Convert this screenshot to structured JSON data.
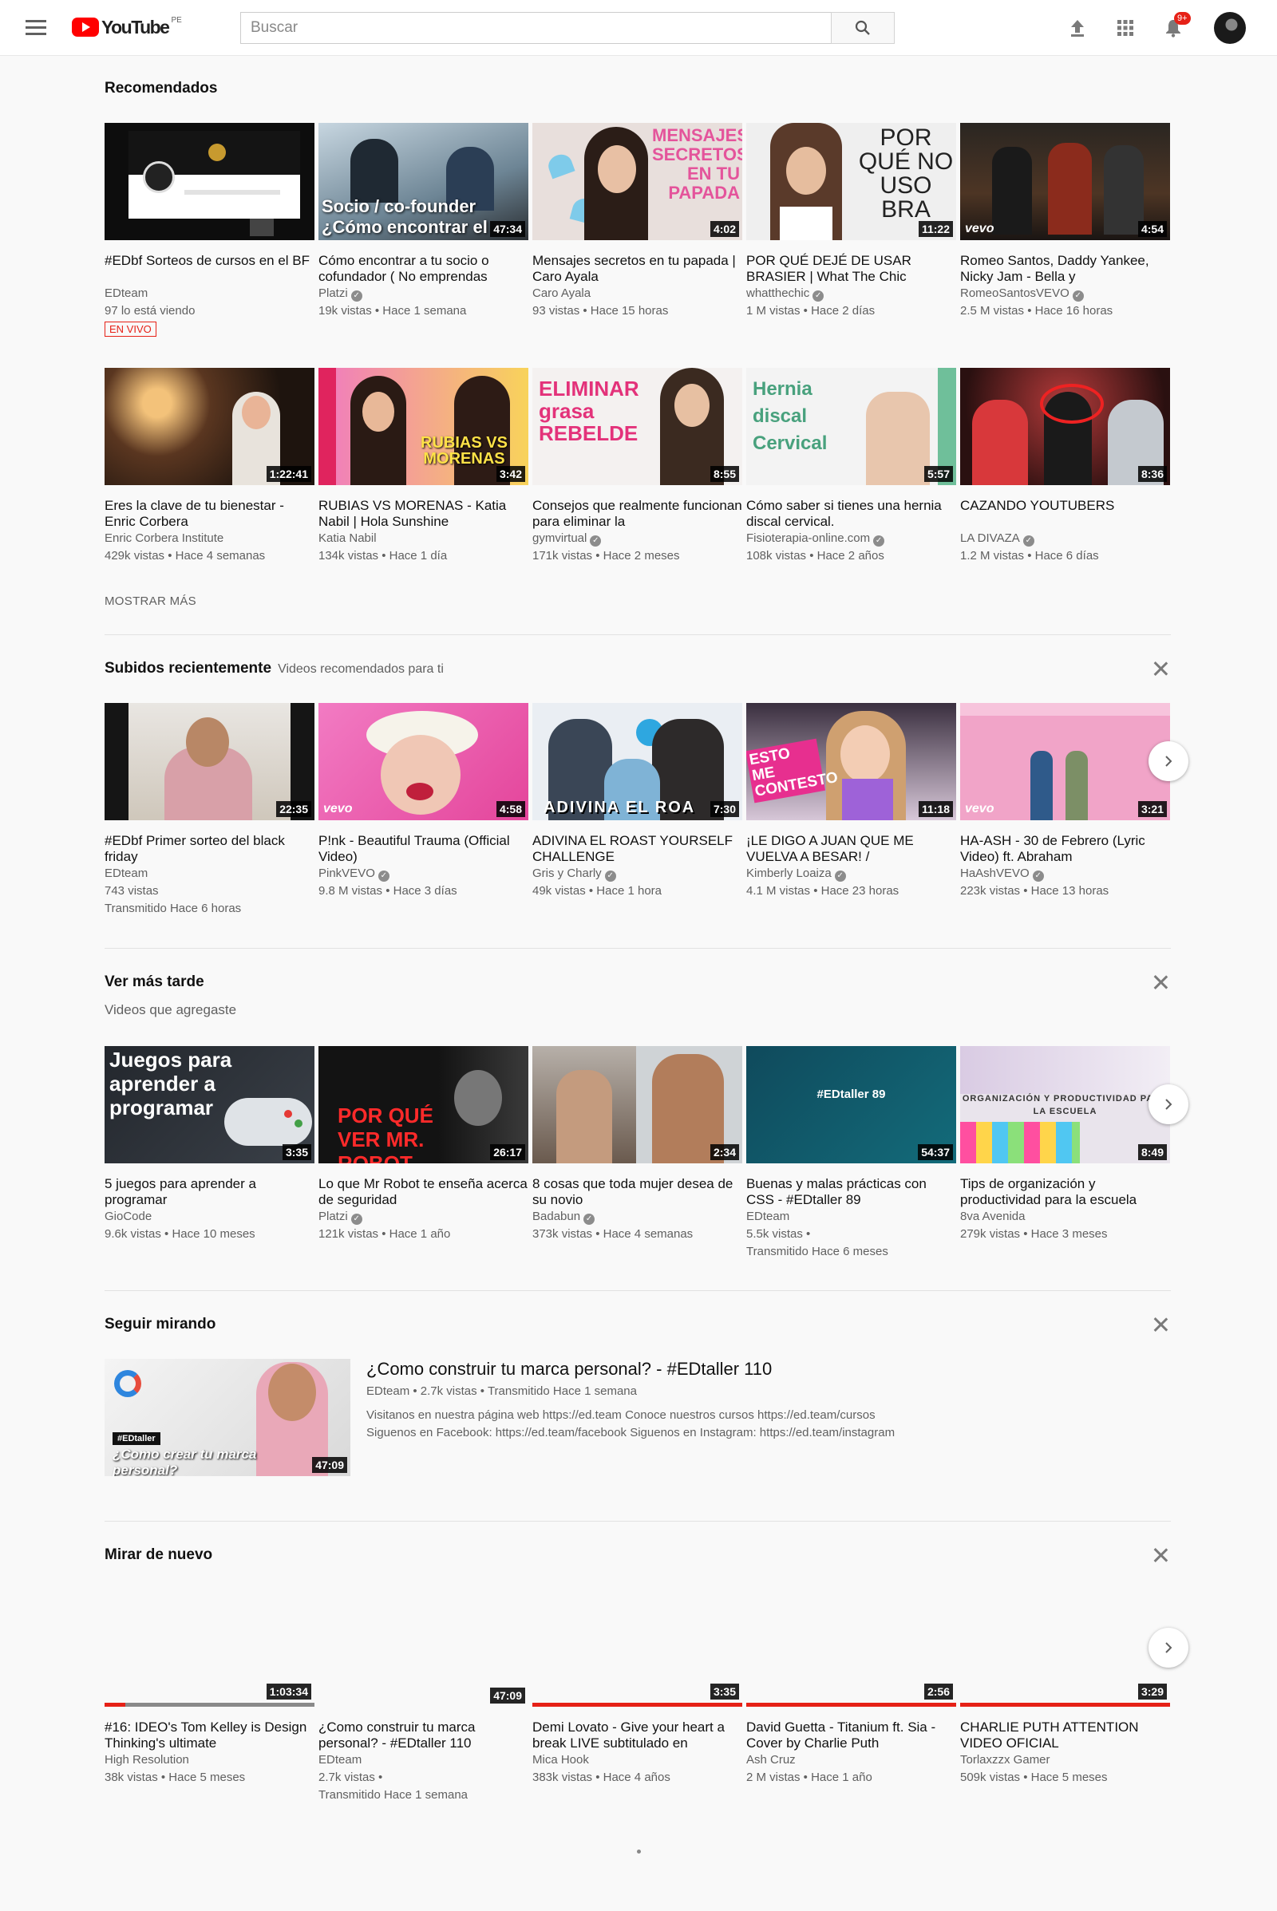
{
  "header": {
    "logo_text": "YouTube",
    "country_code": "PE",
    "search_placeholder": "Buscar",
    "notification_count": "9+"
  },
  "recommended": {
    "title": "Recomendados",
    "show_more": "MOSTRAR MÁS",
    "row1": [
      {
        "title": "#EDbf Sorteos de cursos en el BF",
        "channel": "EDteam",
        "meta": "97 lo está viendo",
        "live": "EN VIVO",
        "duration": ""
      },
      {
        "title": "Cómo encontrar a tu socio o cofundador ( No emprendas",
        "channel": "Platzi",
        "verified": true,
        "meta": "19k vistas • Hace 1 semana",
        "duration": "47:34",
        "thumb_text": "Socio / co-founder ¿Cómo encontrar el correc"
      },
      {
        "title": "Mensajes secretos en tu papada | Caro Ayala",
        "channel": "Caro Ayala",
        "meta": "93 vistas • Hace 15 horas",
        "duration": "4:02",
        "thumb_text": "MENSAJES SECRETOS EN TU PAPADA"
      },
      {
        "title": "POR QUÉ DEJÉ DE USAR BRASIER | What The Chic",
        "channel": "whatthechic",
        "verified": true,
        "meta": "1 M vistas • Hace 2 días",
        "duration": "11:22",
        "thumb_text": "POR QUÉ NO USO BRA"
      },
      {
        "title": "Romeo Santos, Daddy Yankee, Nicky Jam - Bella y",
        "channel": "RomeoSantosVEVO",
        "verified": true,
        "meta": "2.5 M vistas • Hace 16 horas",
        "duration": "4:54",
        "thumb_text": "vevo"
      }
    ],
    "row2": [
      {
        "title": "Eres la clave de tu bienestar - Enric Corbera",
        "channel": "Enric Corbera Institute",
        "meta": "429k vistas • Hace 4 semanas",
        "duration": "1:22:41"
      },
      {
        "title": "RUBIAS VS MORENAS - Katia Nabil | Hola Sunshine",
        "channel": "Katia Nabil",
        "meta": "134k vistas • Hace 1 día",
        "duration": "3:42",
        "thumb_text": "RUBIAS VS MORENAS"
      },
      {
        "title": "Consejos que realmente funcionan para eliminar la",
        "channel": "gymvirtual",
        "verified": true,
        "meta": "171k vistas • Hace 2 meses",
        "duration": "8:55",
        "thumb_text": "ELIMINAR grasa REBELDE"
      },
      {
        "title": "Cómo saber si tienes una hernia discal cervical.",
        "channel": "Fisioterapia-online.com",
        "verified": true,
        "meta": "108k vistas • Hace 2 años",
        "duration": "5:57",
        "thumb_text": "Hernia discal Cervical"
      },
      {
        "title": "CAZANDO YOUTUBERS",
        "channel": "LA DIVAZA",
        "verified": true,
        "meta": "1.2 M vistas • Hace 6 días",
        "duration": "8:36"
      }
    ]
  },
  "recent": {
    "title": "Subidos recientemente",
    "subtitle": "Videos recomendados para ti",
    "items": [
      {
        "title": "#EDbf Primer sorteo del black friday",
        "channel": "EDteam",
        "meta": "743 vistas",
        "meta2": "Transmitido Hace 6 horas",
        "duration": "22:35"
      },
      {
        "title": "P!nk - Beautiful Trauma (Official Video)",
        "channel": "PinkVEVO",
        "verified": true,
        "meta": "9.8 M vistas • Hace 3 días",
        "duration": "4:58",
        "thumb_text": "vevo"
      },
      {
        "title": "ADIVINA EL ROAST YOURSELF CHALLENGE",
        "channel": "Gris y Charly",
        "verified": true,
        "meta": "49k vistas • Hace 1 hora",
        "duration": "7:30",
        "thumb_text": "ADIVINA EL ROA"
      },
      {
        "title": "¡LE DIGO A JUAN QUE ME VUELVA A BESAR! /",
        "channel": "Kimberly Loaiza",
        "verified": true,
        "meta": "4.1 M vistas • Hace 23 horas",
        "duration": "11:18",
        "thumb_text": "ESTO ME CONTESTO"
      },
      {
        "title": "HA-ASH - 30 de Febrero (Lyric Video) ft. Abraham",
        "channel": "HaAshVEVO",
        "verified": true,
        "meta": "223k vistas • Hace 13 horas",
        "duration": "3:21",
        "thumb_text": "vevo"
      }
    ]
  },
  "watch_later": {
    "title": "Ver más tarde",
    "subtitle": "Videos que agregaste",
    "items": [
      {
        "title": "5 juegos para aprender a programar",
        "channel": "GioCode",
        "meta": "9.6k vistas • Hace 10 meses",
        "duration": "3:35",
        "thumb_text": "Juegos para aprender a programar"
      },
      {
        "title": "Lo que Mr Robot te enseña acerca de seguridad",
        "channel": "Platzi",
        "verified": true,
        "meta": "121k vistas • Hace 1 año",
        "duration": "26:17",
        "thumb_text": "POR QUÉ VER MR. ROBOT"
      },
      {
        "title": "8 cosas que toda mujer desea de su novio",
        "channel": "Badabun",
        "verified": true,
        "meta": "373k vistas • Hace 4 semanas",
        "duration": "2:34"
      },
      {
        "title": "Buenas y malas prácticas con CSS - #EDtaller 89",
        "channel": "EDteam",
        "meta": "5.5k vistas •",
        "meta2": "Transmitido Hace 6 meses",
        "duration": "54:37",
        "thumb_text": "#EDtaller 89"
      },
      {
        "title": "Tips de organización y productividad para la escuela",
        "channel": "8va Avenida",
        "meta": "279k vistas • Hace 3 meses",
        "duration": "8:49",
        "thumb_text": "ORGANIZACIÓN Y PRODUCTIVIDAD PARA LA ESCUELA"
      }
    ]
  },
  "continue": {
    "title": "Seguir mirando",
    "video_title": "¿Como construir tu marca personal? - #EDtaller 110",
    "meta": "EDteam • 2.7k vistas • Transmitido Hace 1 semana",
    "desc1": "Visitanos en nuestra página web https://ed.team Conoce nuestros cursos https://ed.team/cursos",
    "desc2": "Siguenos en Facebook: https://ed.team/facebook Siguenos en Instagram: https://ed.team/instagram",
    "duration": "47:09",
    "thumb_tag": "#EDtaller",
    "thumb_text": "¿Como crear tu marca personal?"
  },
  "rewatch": {
    "title": "Mirar de nuevo",
    "items": [
      {
        "title": "#16: IDEO's Tom Kelley is Design Thinking's ultimate",
        "channel": "High Resolution",
        "meta": "38k vistas • Hace 5 meses",
        "duration": "1:03:34",
        "progress": 0.1
      },
      {
        "title": "¿Como construir tu marca personal? - #EDtaller 110",
        "channel": "EDteam",
        "meta": "2.7k vistas •",
        "meta2": "Transmitido Hace 1 semana",
        "duration": "47:09",
        "progress": 0
      },
      {
        "title": "Demi Lovato - Give your heart a break LIVE subtitulado en",
        "channel": "Mica Hook",
        "meta": "383k vistas • Hace 4 años",
        "duration": "3:35",
        "progress": 1
      },
      {
        "title": "David Guetta - Titanium ft. Sia - Cover by Charlie Puth",
        "channel": "Ash Cruz",
        "meta": "2 M vistas • Hace 1 año",
        "duration": "2:56",
        "progress": 1
      },
      {
        "title": "CHARLIE PUTH ATTENTION VIDEO OFICIAL",
        "channel": "Torlaxzzx Gamer",
        "meta": "509k vistas • Hace 5 meses",
        "duration": "3:29",
        "progress": 1
      }
    ]
  },
  "colors": {
    "brand_red": "#ff0000",
    "live_red": "#e62117",
    "bg": "#f9f9f9"
  }
}
